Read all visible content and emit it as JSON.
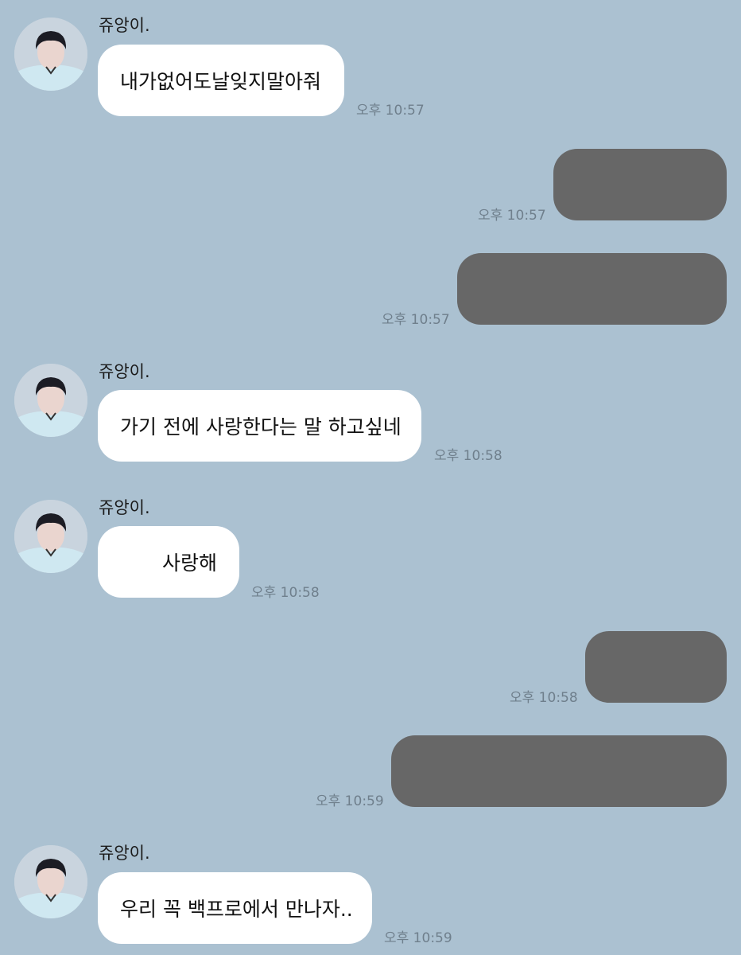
{
  "messages": [
    {
      "sender": "쥬앙이.",
      "text": "내가없어도날잊지말아줘",
      "time": "오후 10:57"
    },
    {
      "time": "오후 10:57"
    },
    {
      "time": "오후 10:57"
    },
    {
      "sender": "쥬앙이.",
      "text": "가기 전에 사랑한다는 말 하고싶네",
      "time": "오후 10:58"
    },
    {
      "sender": "쥬앙이.",
      "text": "사랑해",
      "time": "오후 10:58"
    },
    {
      "time": "오후 10:58"
    },
    {
      "time": "오후 10:59"
    },
    {
      "sender": "쥬앙이.",
      "text": "우리 꼭 백프로에서 만나자..",
      "time": "오후 10:59"
    }
  ],
  "colors": {
    "background": "#abc1d1",
    "incoming_bubble": "#ffffff",
    "outgoing_redacted": "#676767",
    "timestamp": "#6f7f8c"
  }
}
